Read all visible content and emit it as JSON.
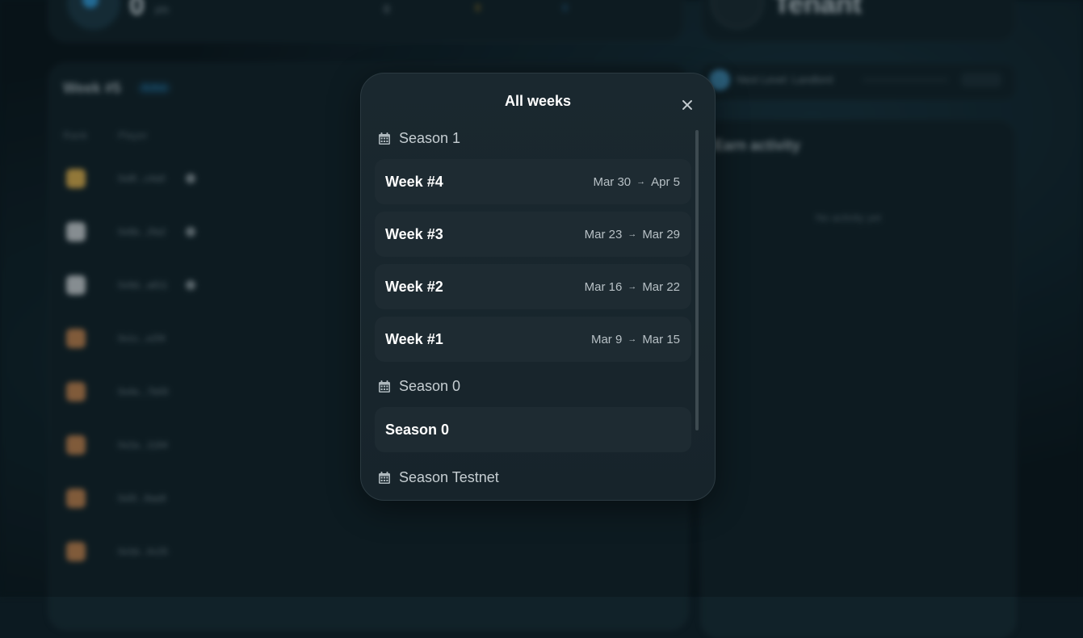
{
  "background": {
    "header_value": "0",
    "header_unit": "pts",
    "header_mid": "0",
    "header_gold": "0",
    "header_blue": "0",
    "tenant_label": "Tenant",
    "leaderboard_title": "Week #5",
    "leaderboard_tag": "Active",
    "columns": [
      "Rank",
      "Player"
    ],
    "rows": [
      {
        "name": "0x8f...c4a0",
        "badge": "gold"
      },
      {
        "name": "0x6b...2fa2",
        "badge": "silver"
      },
      {
        "name": "0x9d...a811",
        "badge": "silver"
      },
      {
        "name": "0x1c...e2f4",
        "badge": "bronze"
      },
      {
        "name": "0x4e...7b00",
        "badge": "bronze"
      },
      {
        "name": "0x2a...1184",
        "badge": "bronze"
      },
      {
        "name": "0x5f...9aa9",
        "badge": "bronze"
      },
      {
        "name": "0x3d...0c25",
        "badge": "bronze"
      }
    ],
    "landlord_label": "Next Level: Landlord",
    "earn_title": "Earn activity",
    "no_activity": "No activity yet"
  },
  "modal": {
    "title": "All weeks",
    "sections": [
      {
        "name": "Season 1",
        "items": [
          {
            "label": "Week #4",
            "start": "Mar 30",
            "end": "Apr 5"
          },
          {
            "label": "Week #3",
            "start": "Mar 23",
            "end": "Mar 29"
          },
          {
            "label": "Week #2",
            "start": "Mar 16",
            "end": "Mar 22"
          },
          {
            "label": "Week #1",
            "start": "Mar 9",
            "end": "Mar 15"
          }
        ]
      },
      {
        "name": "Season 0",
        "items": [
          {
            "label": "Season 0"
          }
        ]
      },
      {
        "name": "Season Testnet",
        "items": []
      }
    ],
    "arrow": "→",
    "colors": {
      "modal_bg": "#1a282f",
      "item_bg": "#1e2b32",
      "text_primary": "#ffffff",
      "text_secondary": "#b7c0c5"
    },
    "icons": {
      "close": "close-icon",
      "section": "calendar-icon",
      "range_separator": "arrow-right-icon"
    }
  }
}
